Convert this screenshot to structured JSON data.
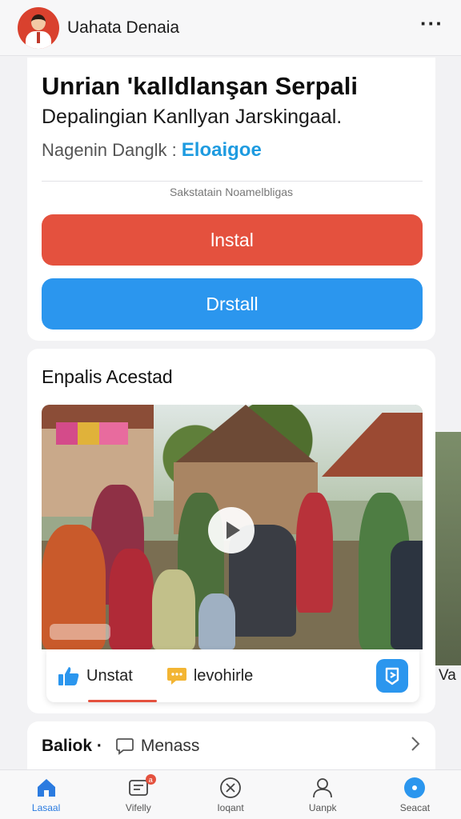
{
  "header": {
    "title": "Uahata Denaia",
    "more_icon": "more-horizontal-icon"
  },
  "promo": {
    "headline": "Unrian 'kalldlanşan Serpali",
    "subline": "Depalingian Kanllyan Jarskingaal.",
    "meta_label": "Nagenin Danglk :",
    "brand": "Eloaigoe",
    "note": "Sakstatain  Noamelbligas",
    "primary_button": "lnstal",
    "secondary_button": "Drstall"
  },
  "feed": {
    "section_title": "Enpalis Acestad",
    "video": {
      "state": "paused",
      "play_icon": "play-icon"
    },
    "actions": [
      {
        "label": "Unstat",
        "icon": "thumbs-up-icon"
      },
      {
        "label": "levohirle",
        "icon": "comment-icon"
      }
    ],
    "fab_icon": "share-icon",
    "peek_label": "Va"
  },
  "info": {
    "label": "Baliok ·",
    "link": "Menass",
    "chevron_icon": "chevron-right-icon"
  },
  "nav": {
    "items": [
      {
        "label": "Lasaal",
        "icon": "home-icon",
        "active": true
      },
      {
        "label": "Vifelly",
        "icon": "cart-icon",
        "badge": "a"
      },
      {
        "label": "Ioqant",
        "icon": "close-circle-icon"
      },
      {
        "label": "Uanpk",
        "icon": "user-icon"
      },
      {
        "label": "Seacat",
        "icon": "dot-circle-icon"
      }
    ]
  },
  "colors": {
    "primary_red": "#e4513e",
    "primary_blue": "#2b96ee",
    "brand_blue": "#1e9be0",
    "active_nav": "#2b7be0"
  }
}
